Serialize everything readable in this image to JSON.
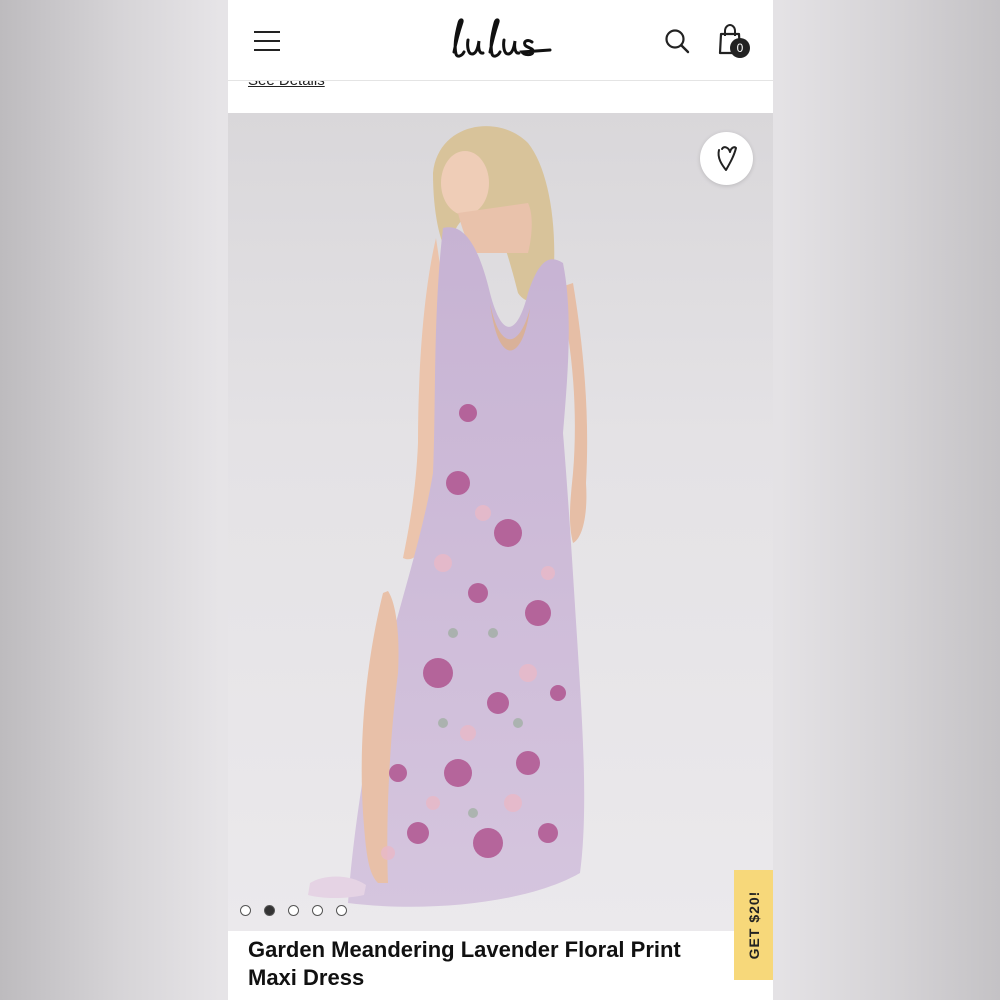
{
  "header": {
    "logo_text": "Lulus",
    "menu_icon": "hamburger-icon",
    "search_icon": "search-icon",
    "bag_icon": "shopping-bag-icon",
    "cart_count": "0"
  },
  "promo": {
    "see_details": "See Details"
  },
  "product": {
    "favorite_icon": "heart-icon",
    "image_count": 5,
    "active_image": 2,
    "title": "Garden Meandering Lavender Floral Print Maxi Dress"
  },
  "floating": {
    "offer_label": "GET $20!"
  },
  "colors": {
    "accent_yellow": "#f7d87a",
    "dress_lavender": "#c9b6d6",
    "floral_pink": "#b05590",
    "text_dark": "#111111"
  }
}
